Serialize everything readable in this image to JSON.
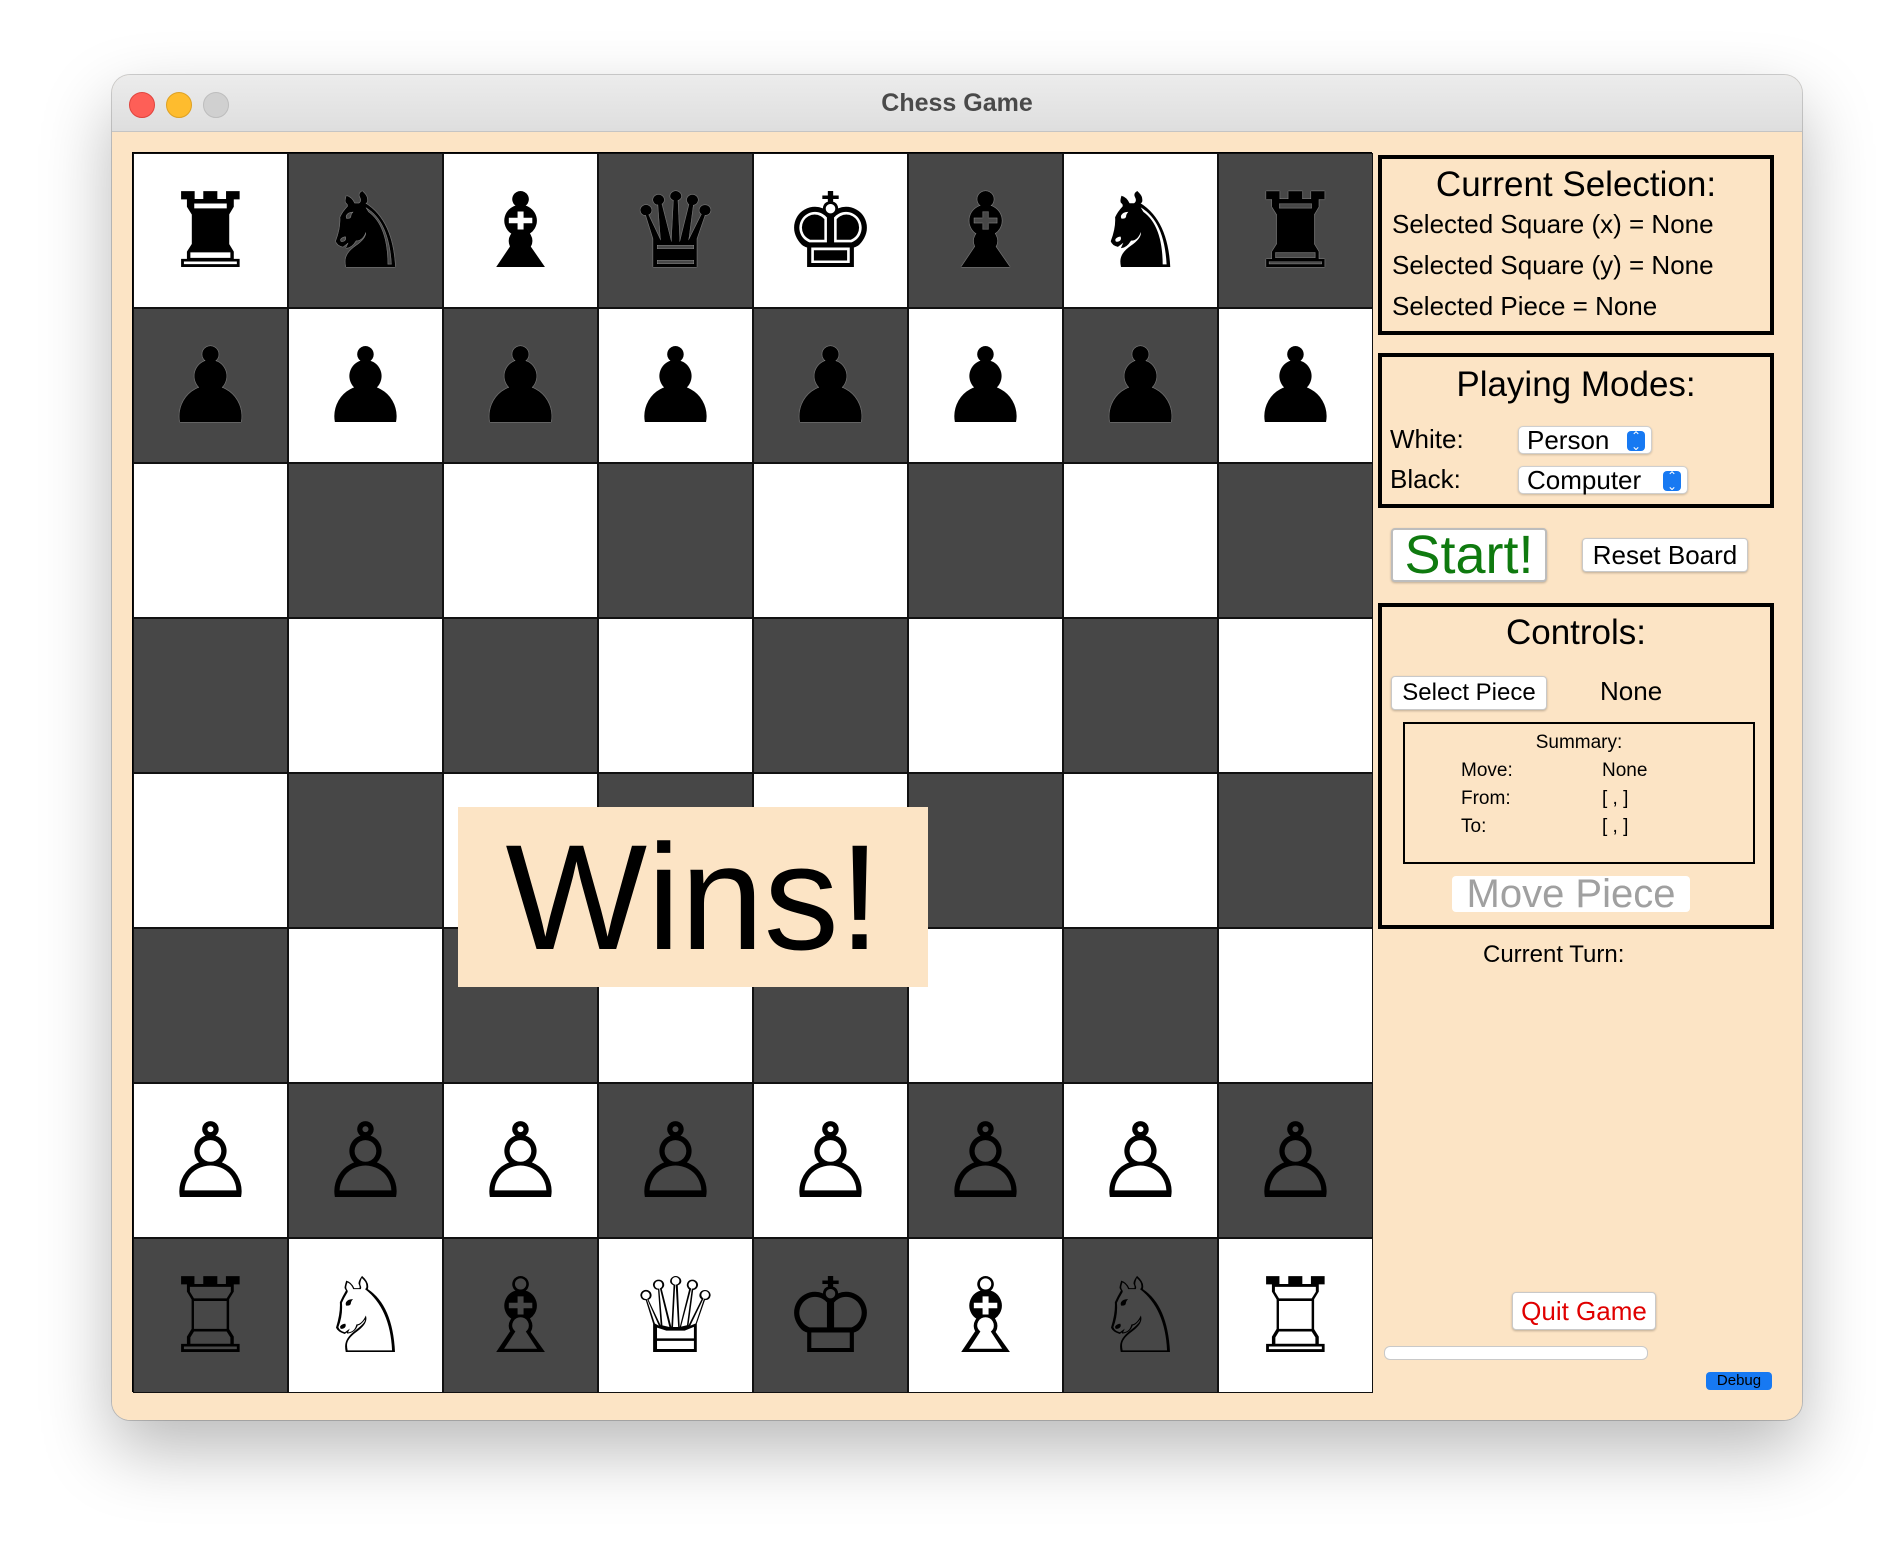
{
  "window": {
    "title": "Chess Game"
  },
  "board": {
    "pieces": [
      [
        "♜",
        "♞",
        "♝",
        "♛",
        "♚",
        "♝",
        "♞",
        "♜"
      ],
      [
        "♟",
        "♟",
        "♟",
        "♟",
        "♟",
        "♟",
        "♟",
        "♟"
      ],
      [
        "",
        "",
        "",
        "",
        "",
        "",
        "",
        ""
      ],
      [
        "",
        "",
        "",
        "",
        "",
        "",
        "",
        ""
      ],
      [
        "",
        "",
        "",
        "",
        "",
        "",
        "",
        ""
      ],
      [
        "",
        "",
        "",
        "",
        "",
        "",
        "",
        ""
      ],
      [
        "♙",
        "♙",
        "♙",
        "♙",
        "♙",
        "♙",
        "♙",
        "♙"
      ],
      [
        "♖",
        "♘",
        "♗",
        "♕",
        "♔",
        "♗",
        "♘",
        "♖"
      ]
    ],
    "banner": "Wins!"
  },
  "selection": {
    "heading": "Current Selection:",
    "square_x": "Selected Square (x) = None",
    "square_y": "Selected Square (y) = None",
    "piece": "Selected Piece = None"
  },
  "modes": {
    "heading": "Playing Modes:",
    "white_label": "White:",
    "white_value": "Person",
    "black_label": "Black:",
    "black_value": "Computer"
  },
  "actions": {
    "start_label": "Start!",
    "reset_label": "Reset Board"
  },
  "controls": {
    "heading": "Controls:",
    "select_piece_label": "Select Piece",
    "selected_value": "None",
    "summary": {
      "title": "Summary:",
      "move_label": "Move:",
      "move_value": "None",
      "from_label": "From:",
      "from_value": "[ , ]",
      "to_label": "To:",
      "to_value": "[ , ]"
    },
    "move_piece_label": "Move Piece"
  },
  "turn": {
    "label": "Current Turn:"
  },
  "quit_label": "Quit Game",
  "debug_label": "Debug",
  "colors": {
    "start": "#0f7a0f",
    "quit": "#e00000",
    "disabled": "#a0a0a0",
    "panel_bg": "#fce4c5",
    "dark_square": "#474747"
  }
}
